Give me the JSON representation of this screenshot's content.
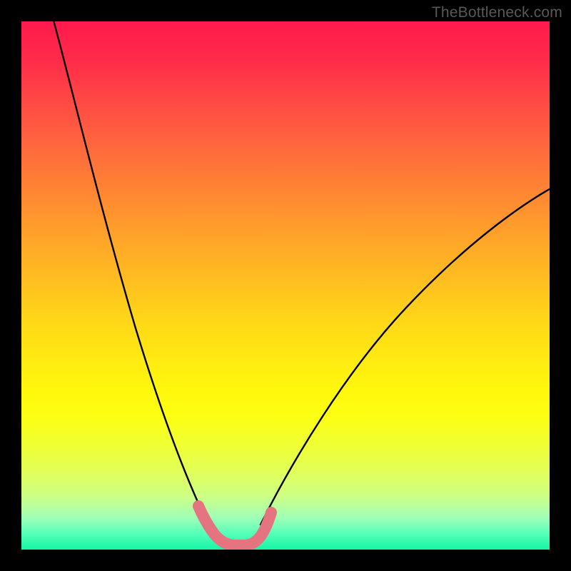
{
  "watermark": {
    "text": "TheBottleneck.com"
  },
  "chart_data": {
    "type": "line",
    "title": "",
    "xlabel": "",
    "ylabel": "",
    "xlim": [
      0,
      100
    ],
    "ylim": [
      0,
      100
    ],
    "gradient_stops": [
      {
        "pos": 0,
        "color": "#ff1a4d"
      },
      {
        "pos": 50,
        "color": "#ffd518"
      },
      {
        "pos": 75,
        "color": "#fcff14"
      },
      {
        "pos": 100,
        "color": "#14f5a5"
      }
    ],
    "series": [
      {
        "name": "left-branch",
        "color": "#000000",
        "x": [
          6,
          8,
          10,
          12,
          14,
          16,
          18,
          20,
          22,
          24,
          26,
          28,
          30,
          32,
          34,
          35.5
        ],
        "y": [
          100,
          92,
          84,
          76,
          68,
          60,
          52,
          45,
          38,
          31,
          25,
          19,
          14,
          9,
          5,
          2.5
        ]
      },
      {
        "name": "right-branch",
        "color": "#000000",
        "x": [
          45.5,
          48,
          52,
          56,
          60,
          64,
          68,
          72,
          76,
          80,
          84,
          88,
          92,
          96,
          100
        ],
        "y": [
          2.5,
          5,
          10,
          15,
          20,
          25,
          30,
          35,
          40,
          44,
          48,
          52,
          56,
          59,
          62
        ]
      },
      {
        "name": "highlight-u",
        "color": "#e4747f",
        "x": [
          33.5,
          35,
          36.5,
          38,
          40,
          42,
          44,
          45.5,
          47
        ],
        "y": [
          7.5,
          4.5,
          2.5,
          1.2,
          0.8,
          1.2,
          2.5,
          4.5,
          7.5
        ]
      }
    ]
  }
}
